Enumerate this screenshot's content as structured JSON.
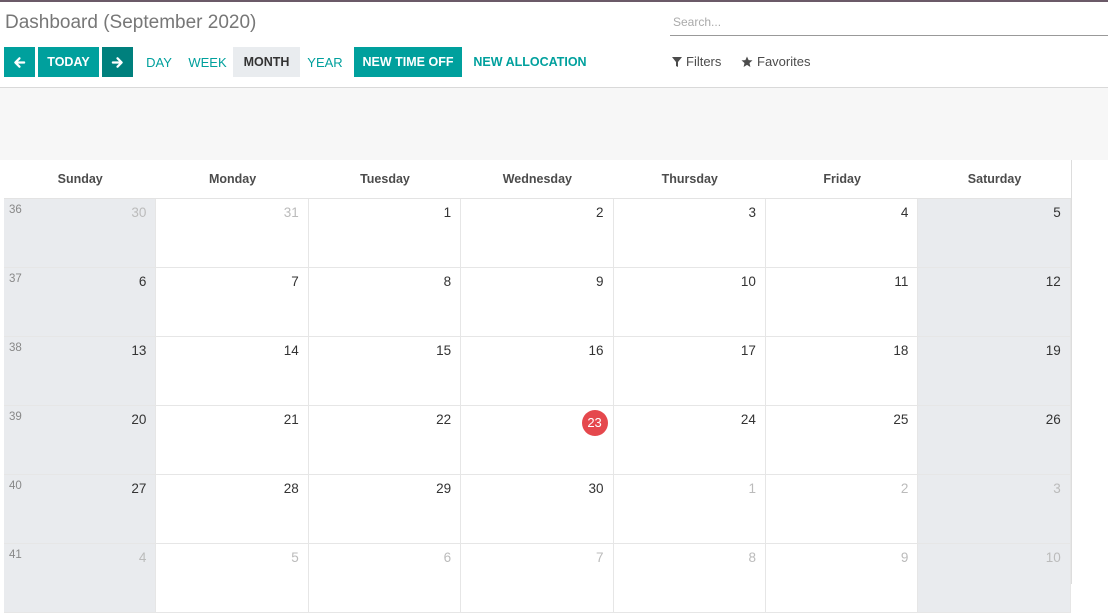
{
  "header": {
    "title": "Dashboard (September 2020)"
  },
  "search": {
    "placeholder": "Search..."
  },
  "toolbar": {
    "prev_icon": "arrow-left-icon",
    "today_label": "TODAY",
    "next_icon": "arrow-right-icon",
    "day_label": "DAY",
    "week_label": "WEEK",
    "month_label": "MONTH",
    "year_label": "YEAR",
    "new_time_off_label": "NEW TIME OFF",
    "new_allocation_label": "NEW ALLOCATION",
    "filters_label": "Filters",
    "favorites_label": "Favorites",
    "active_scale": "MONTH"
  },
  "colors": {
    "primary": "#00a09d",
    "today": "#e5484d",
    "weekend": "#e9ebee"
  },
  "calendar": {
    "days": [
      "Sunday",
      "Monday",
      "Tuesday",
      "Wednesday",
      "Thursday",
      "Friday",
      "Saturday"
    ],
    "today": 23,
    "weeks": [
      {
        "week": "36",
        "dates": [
          "30",
          "31",
          "1",
          "2",
          "3",
          "4",
          "5"
        ]
      },
      {
        "week": "37",
        "dates": [
          "6",
          "7",
          "8",
          "9",
          "10",
          "11",
          "12"
        ]
      },
      {
        "week": "38",
        "dates": [
          "13",
          "14",
          "15",
          "16",
          "17",
          "18",
          "19"
        ]
      },
      {
        "week": "39",
        "dates": [
          "20",
          "21",
          "22",
          "23",
          "24",
          "25",
          "26"
        ]
      },
      {
        "week": "40",
        "dates": [
          "27",
          "28",
          "29",
          "30",
          "1",
          "2",
          "3"
        ]
      },
      {
        "week": "41",
        "dates": [
          "4",
          "5",
          "6",
          "7",
          "8",
          "9",
          "10"
        ]
      }
    ]
  }
}
